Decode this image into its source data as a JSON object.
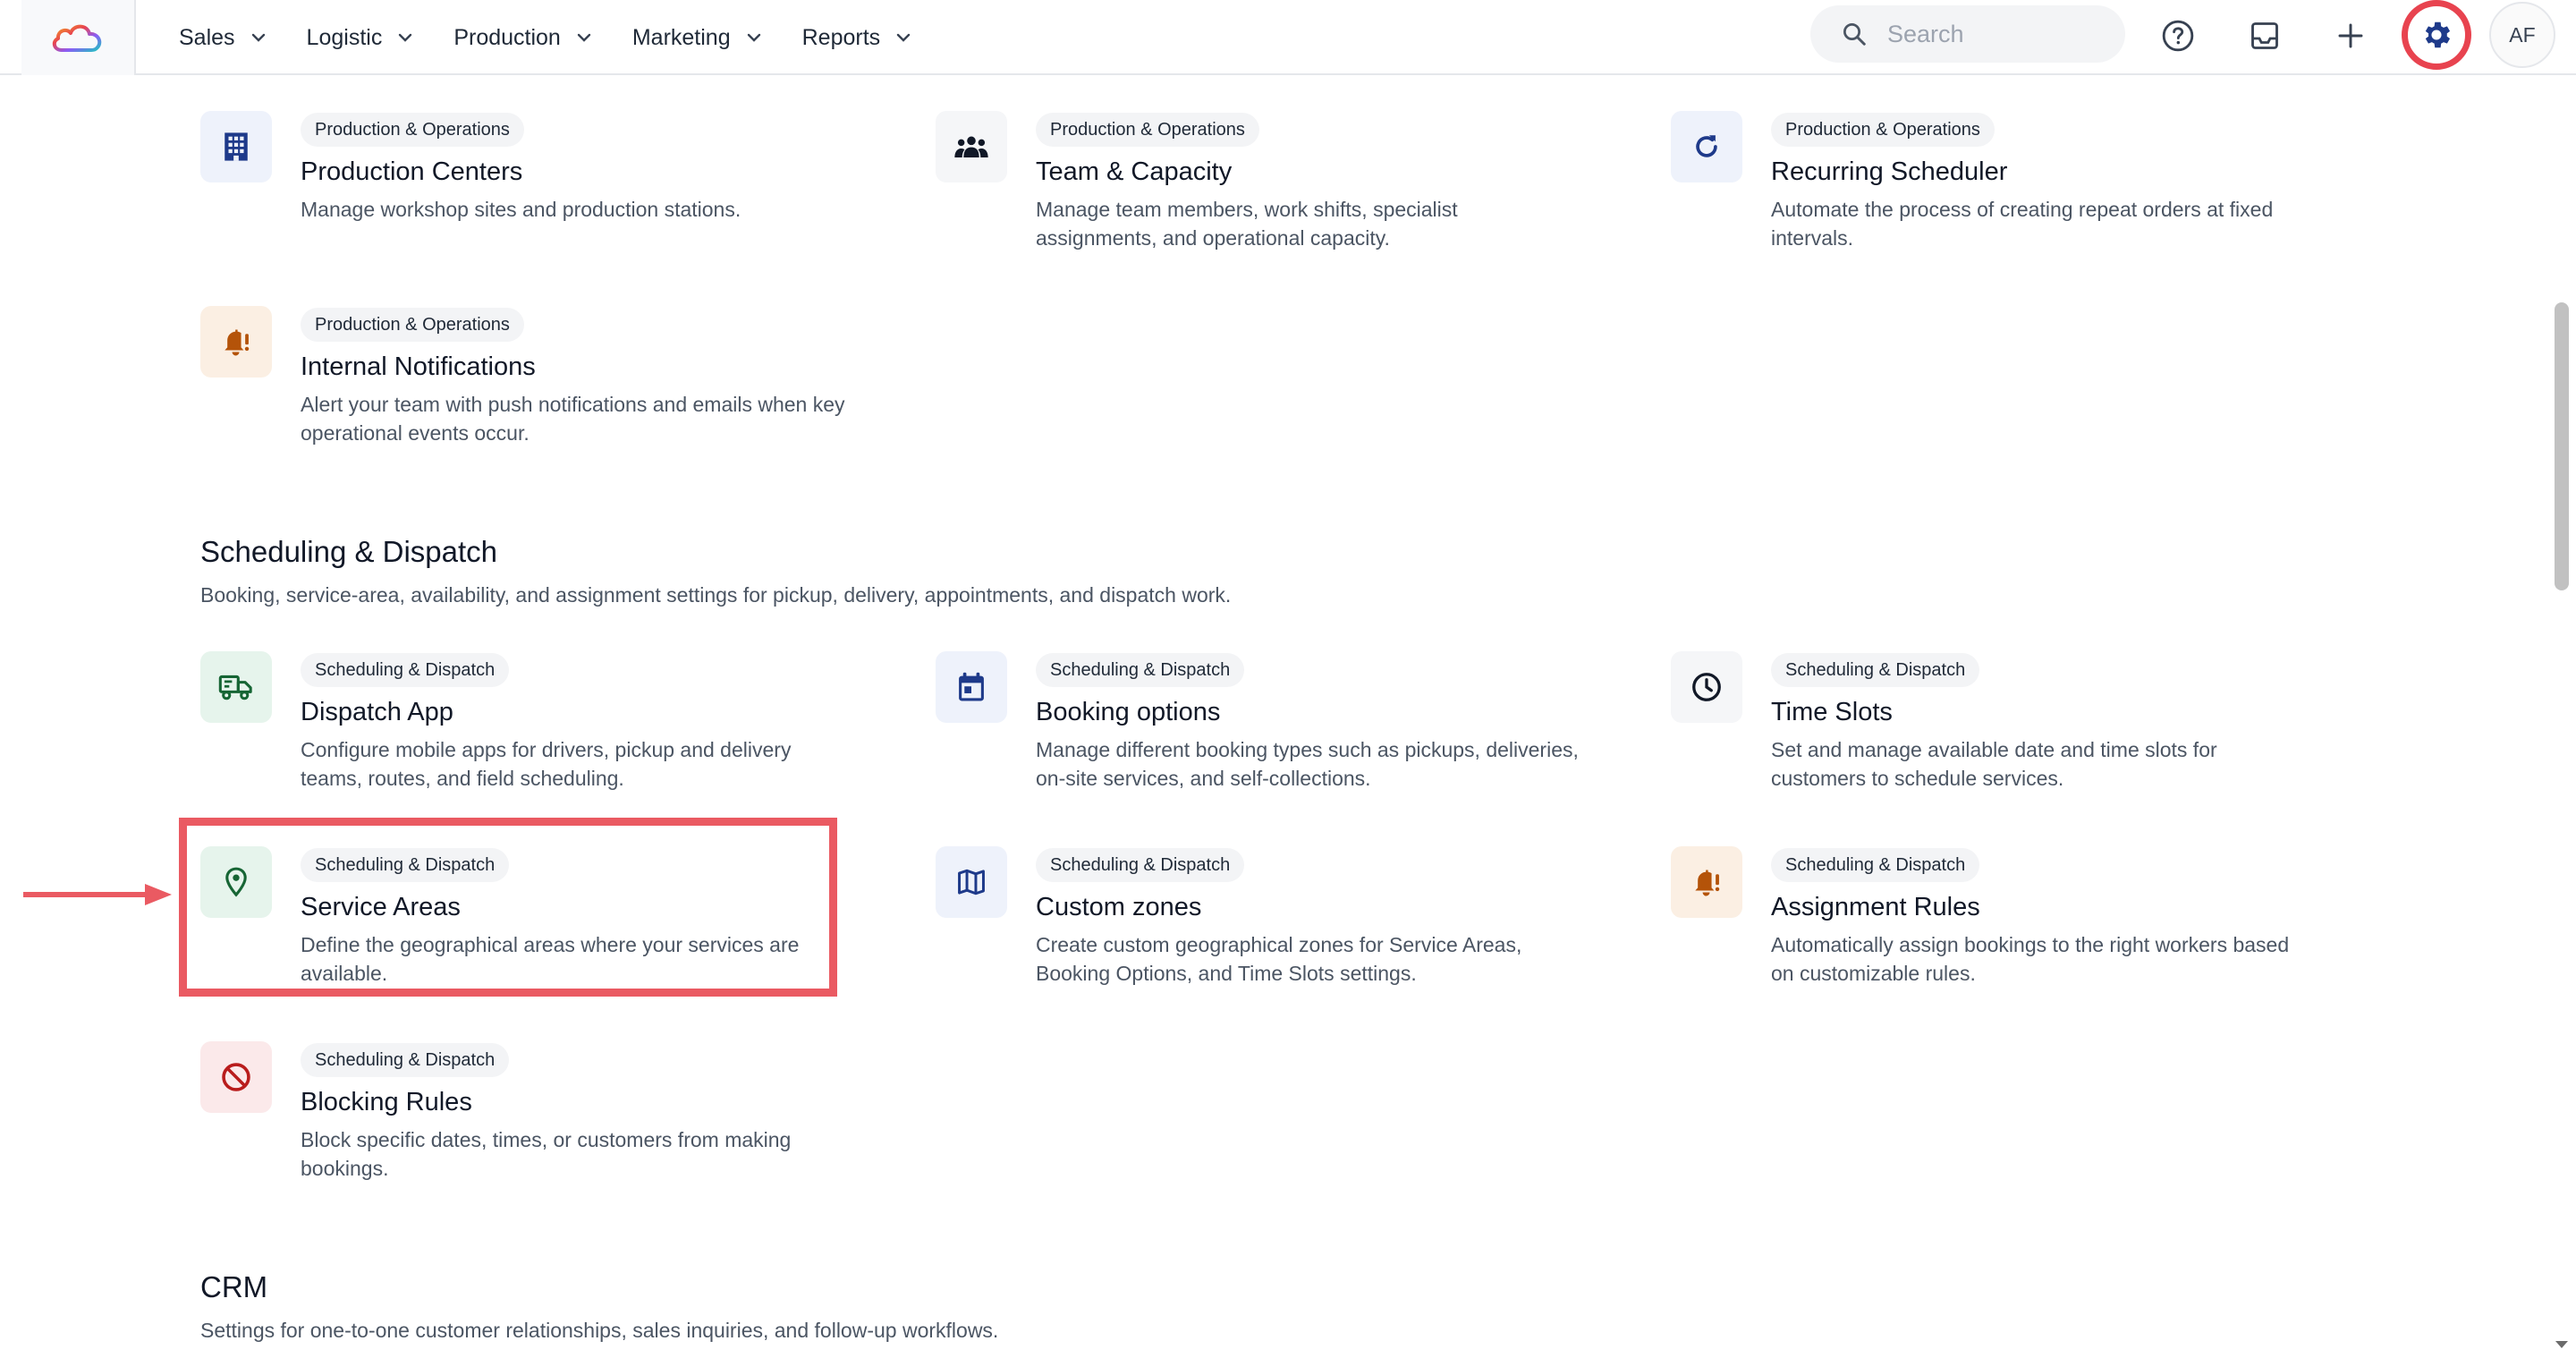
{
  "nav": {
    "items": [
      {
        "label": "Sales"
      },
      {
        "label": "Logistic"
      },
      {
        "label": "Production"
      },
      {
        "label": "Marketing"
      },
      {
        "label": "Reports"
      }
    ]
  },
  "topbar": {
    "search_placeholder": "Search",
    "avatar_initials": "AF",
    "icons": [
      "help-icon",
      "inbox-icon",
      "plus-icon",
      "gear-icon"
    ]
  },
  "production_cards": [
    {
      "tag": "Production & Operations",
      "title": "Production Centers",
      "desc": "Manage workshop sites and production stations.",
      "icon": "building-icon"
    },
    {
      "tag": "Production & Operations",
      "title": "Team & Capacity",
      "desc": "Manage team members, work shifts, specialist assignments, and operational capacity.",
      "icon": "team-icon"
    },
    {
      "tag": "Production & Operations",
      "title": "Recurring Scheduler",
      "desc": "Automate the process of creating repeat orders at fixed intervals.",
      "icon": "refresh-icon"
    },
    {
      "tag": "Production & Operations",
      "title": "Internal Notifications",
      "desc": "Alert your team with push notifications and emails when key operational events occur.",
      "icon": "bell-alert-icon"
    }
  ],
  "scheduling": {
    "title": "Scheduling & Dispatch",
    "desc": "Booking, service-area, availability, and assignment settings for pickup, delivery, appointments, and dispatch work.",
    "cards": [
      {
        "tag": "Scheduling & Dispatch",
        "title": "Dispatch App",
        "desc": "Configure mobile apps for drivers, pickup and delivery teams, routes, and field scheduling.",
        "icon": "delivery-truck-icon"
      },
      {
        "tag": "Scheduling & Dispatch",
        "title": "Booking options",
        "desc": "Manage different booking types such as pickups, deliveries, on-site services, and self-collections.",
        "icon": "calendar-icon"
      },
      {
        "tag": "Scheduling & Dispatch",
        "title": "Time Slots",
        "desc": "Set and manage available date and time slots for customers to schedule services.",
        "icon": "clock-icon"
      },
      {
        "tag": "Scheduling & Dispatch",
        "title": "Service Areas",
        "desc": "Define the geographical areas where your services are available.",
        "icon": "map-pin-icon"
      },
      {
        "tag": "Scheduling & Dispatch",
        "title": "Custom zones",
        "desc": "Create custom geographical zones for Service Areas, Booking Options, and Time Slots settings.",
        "icon": "map-icon"
      },
      {
        "tag": "Scheduling & Dispatch",
        "title": "Assignment Rules",
        "desc": "Automatically assign bookings to the right workers based on customizable rules.",
        "icon": "bell-alert-icon"
      },
      {
        "tag": "Scheduling & Dispatch",
        "title": "Blocking Rules",
        "desc": "Block specific dates, times, or customers from making bookings.",
        "icon": "block-icon"
      }
    ]
  },
  "crm": {
    "title": "CRM",
    "desc": "Settings for one-to-one customer relationships, sales inquiries, and follow-up workflows."
  },
  "colors": {
    "accent_blue": "#1e3a8a",
    "highlight_red": "#ea5a62",
    "icon_orange": "#b45309",
    "icon_green": "#166534",
    "icon_red": "#b91c1c"
  }
}
